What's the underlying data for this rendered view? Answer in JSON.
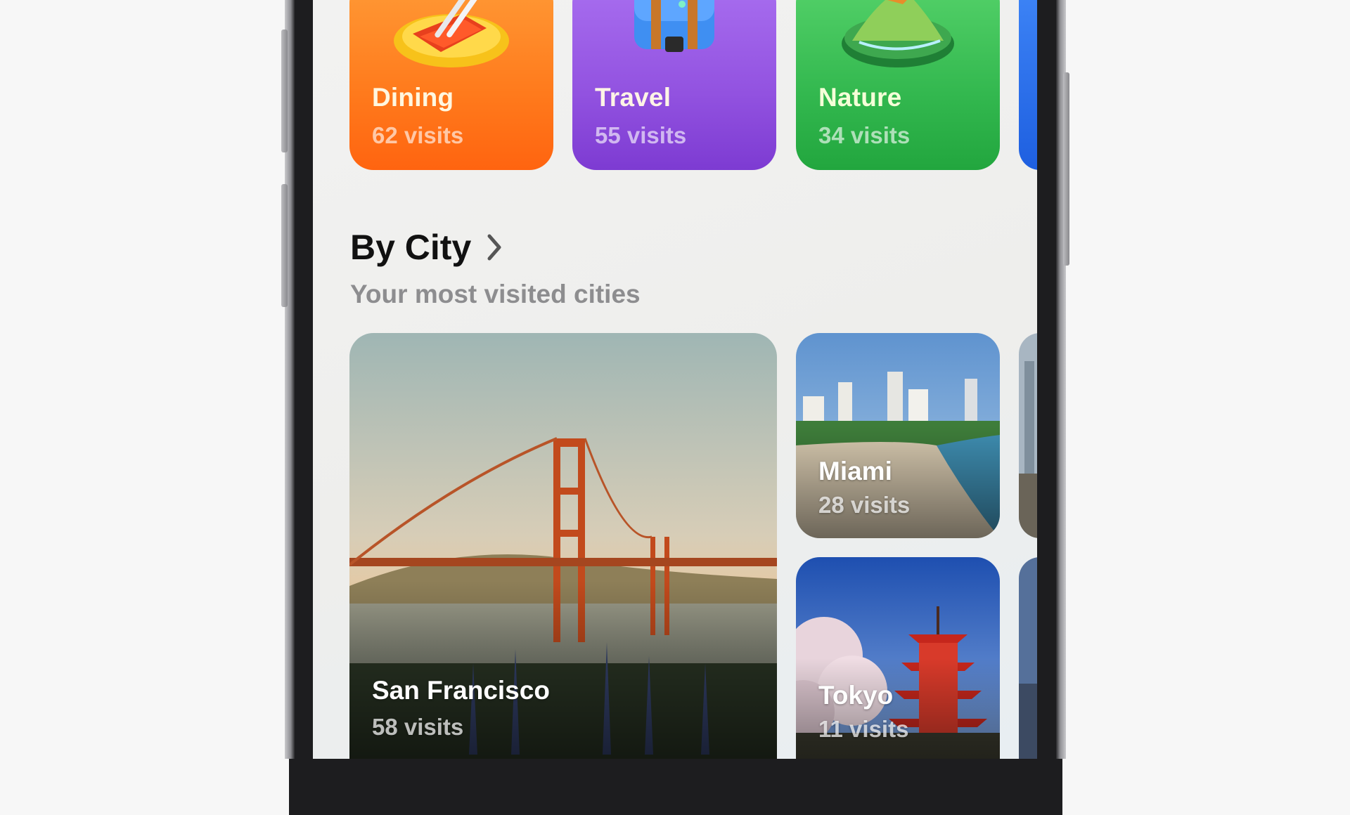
{
  "categories": [
    {
      "title": "Dining",
      "count": "62 visits",
      "icon": "dining-plate-icon"
    },
    {
      "title": "Travel",
      "count": "55 visits",
      "icon": "suitcase-icon"
    },
    {
      "title": "Nature",
      "count": "34 visits",
      "icon": "mountain-island-icon"
    }
  ],
  "by_city": {
    "title": "By City",
    "subtitle": "Your most visited cities",
    "cities": [
      {
        "name": "San Francisco",
        "count": "58 visits"
      },
      {
        "name": "Miami",
        "count": "28 visits"
      },
      {
        "name": "Tokyo",
        "count": "11 visits"
      }
    ]
  },
  "colors": {
    "dining": "#ff7a1c",
    "travel": "#9252e0",
    "nature": "#33b84f",
    "peek": "#2f72ec"
  }
}
